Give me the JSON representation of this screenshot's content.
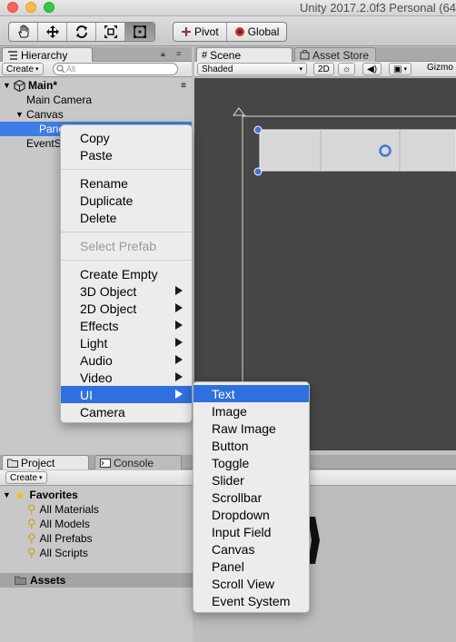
{
  "window": {
    "title": "Unity 2017.2.0f3 Personal (64",
    "traffic_colors": {
      "close": "#fc605c",
      "minimize": "#fdbc40",
      "maximize": "#34c84a"
    }
  },
  "toolbar": {
    "tools": [
      "hand-tool",
      "move-tool",
      "rotate-tool",
      "scale-tool",
      "rect-tool"
    ],
    "active_tool": "rect-tool",
    "pivot_label": "Pivot",
    "global_label": "Global"
  },
  "hierarchy": {
    "tab_label": "Hierarchy",
    "create_label": "Create",
    "search_placeholder": "All",
    "scene_name": "Main*",
    "items": [
      {
        "label": "Main Camera"
      },
      {
        "label": "Canvas"
      },
      {
        "label": "Panel"
      },
      {
        "label": "EventSystem"
      }
    ]
  },
  "scene": {
    "tab_label": "Scene",
    "asset_store_label": "Asset Store",
    "shading_mode": "Shaded",
    "mode_2d_label": "2D",
    "gizmos_label": "Gizmo"
  },
  "project": {
    "tab_label": "Project",
    "console_label": "Console",
    "create_label": "Create",
    "favorites_label": "Favorites",
    "favorites": [
      {
        "label": "All Materials"
      },
      {
        "label": "All Models"
      },
      {
        "label": "All Prefabs"
      },
      {
        "label": "All Scripts"
      }
    ],
    "assets_label": "Assets"
  },
  "context_menu": {
    "copy": "Copy",
    "paste": "Paste",
    "rename": "Rename",
    "duplicate": "Duplicate",
    "delete": "Delete",
    "select_prefab": "Select Prefab",
    "create_empty": "Create Empty",
    "object_3d": "3D Object",
    "object_2d": "2D Object",
    "effects": "Effects",
    "light": "Light",
    "audio": "Audio",
    "video": "Video",
    "ui": "UI",
    "camera": "Camera"
  },
  "ui_submenu": {
    "items": [
      "Text",
      "Image",
      "Raw Image",
      "Button",
      "Toggle",
      "Slider",
      "Scrollbar",
      "Dropdown",
      "Input Field",
      "Canvas",
      "Panel",
      "Scroll View",
      "Event System"
    ],
    "highlighted": "Text"
  },
  "colors": {
    "selection": "#3e7de5",
    "menu_highlight": "#2f6fe0",
    "scene_bg": "#464646"
  }
}
